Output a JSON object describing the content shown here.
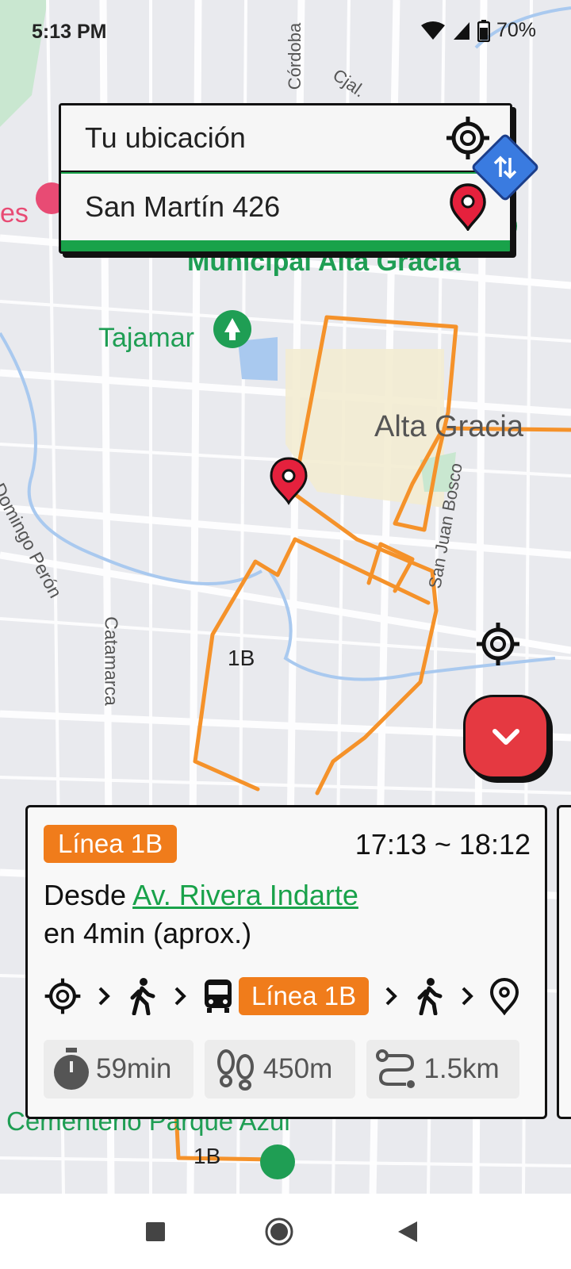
{
  "status_bar": {
    "time": "5:13 PM",
    "battery": "70%",
    "icons": [
      "wifi-icon",
      "signal-icon",
      "battery-icon"
    ]
  },
  "search": {
    "origin": "Tu ubicación",
    "destination": "San Martín 426",
    "icons": {
      "origin": "crosshair-icon",
      "destination": "pin-icon",
      "swap": "swap-icon"
    }
  },
  "map": {
    "labels": {
      "cordoba": "Córdoba",
      "cjal": "Cjal.",
      "municipal": "Municipal Alta Gracia",
      "tajamar": "Tajamar",
      "alta_gracia": "Alta Gracia",
      "juan_domingo_peron": "Juan Domingo Perón",
      "san_juan_bosco": "San Juan Bosco",
      "catamarca": "Catamarca",
      "route_1b": "1B",
      "cementerio": "Cementerio Parque Azul",
      "route_1b_bottom": "1B",
      "es": "es"
    },
    "route_color": "#f5922a"
  },
  "route_card": {
    "line": "Línea 1B",
    "time_range": "17:13 ~ 18:12",
    "desde_prefix": "Desde ",
    "stop": "Av. Rivera Indarte",
    "eta": "en 4min (aprox.)",
    "steps": {
      "origin_icon": "crosshair-icon",
      "walk_icon": "walk-icon",
      "bus_icon": "bus-icon",
      "line": "Línea 1B",
      "dest_icon": "pin-outline-icon"
    },
    "stats": {
      "duration": "59min",
      "walking": "450m",
      "distance": "1.5km"
    }
  },
  "colors": {
    "accent_orange": "#f07c1b",
    "accent_green": "#19a24a",
    "accent_red": "#e53941",
    "swap_blue": "#3a7be0"
  },
  "nav": {
    "buttons": [
      "recents-button",
      "home-button",
      "back-button"
    ]
  }
}
